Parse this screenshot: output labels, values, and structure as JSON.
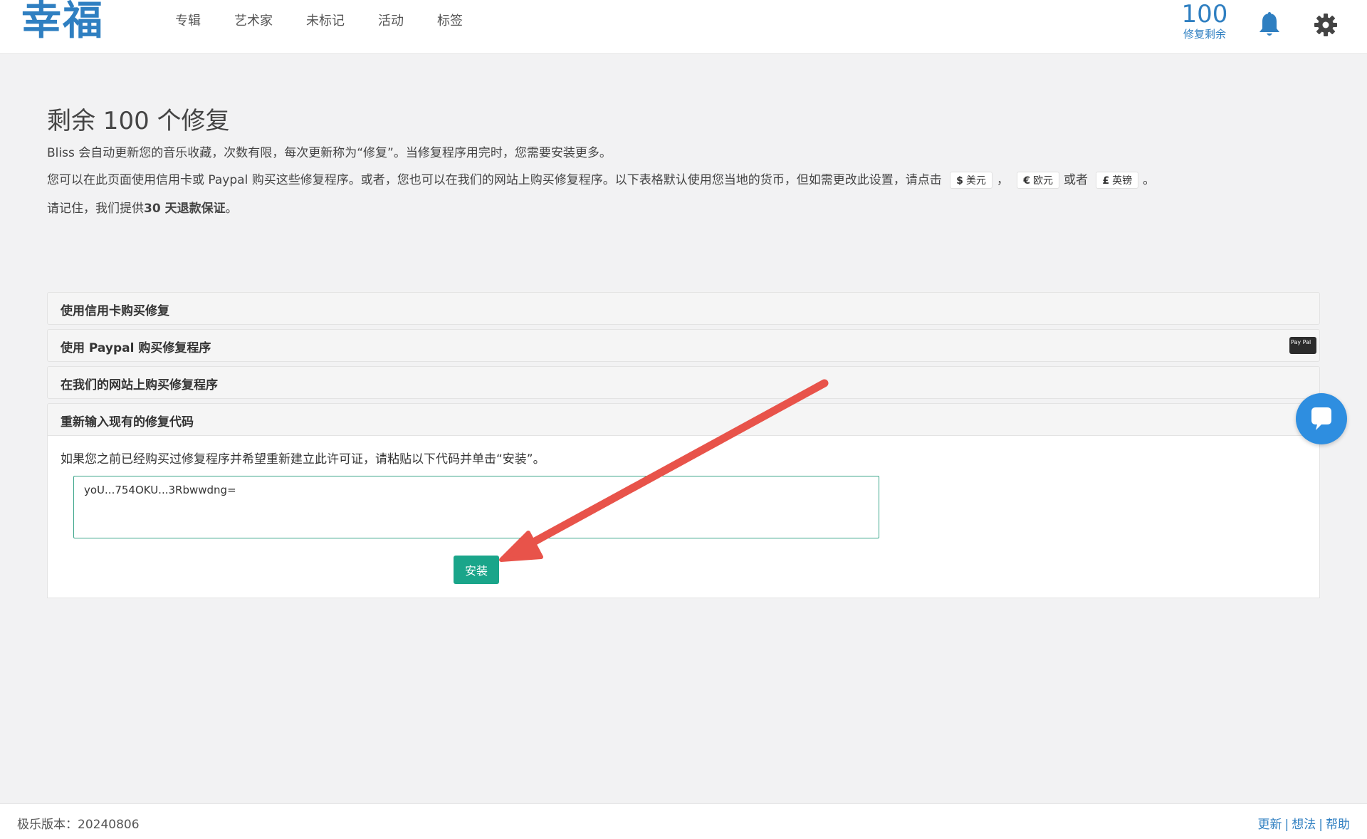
{
  "header": {
    "logo": "幸福",
    "nav": [
      "专辑",
      "艺术家",
      "未标记",
      "活动",
      "标签"
    ],
    "fix_count": "100",
    "fix_label": "修复剩余"
  },
  "main": {
    "title": "剩余 100 个修复",
    "p1": "Bliss 会自动更新您的音乐收藏，次数有限，每次更新称为“修复”。当修复程序用完时，您需要安装更多。",
    "p2_before": "您可以在此页面使用信用卡或 Paypal 购买这些修复程序。或者，您也可以在我们的网站上购买修复程序。以下表格默认使用您当地的货币，但如需更改此设置，请点击",
    "currency_usd": {
      "symbol": "$",
      "label": "美元"
    },
    "sep_comma": "，",
    "currency_eur": {
      "symbol": "€",
      "label": "欧元"
    },
    "or_text": "或者",
    "currency_gbp": {
      "symbol": "£",
      "label": "英镑"
    },
    "p2_end": "。",
    "p3_before": "请记住，我们提供",
    "p3_bold": "30 天退款保证",
    "p3_after": "。"
  },
  "accordion": {
    "items": [
      "使用信用卡购买修复",
      "使用 Paypal 购买修复程序",
      "在我们的网站上购买修复程序",
      "重新输入现有的修复代码"
    ],
    "panel_text": "如果您之前已经购买过修复程序并希望重新建立此许可证，请粘贴以下代码并单击“安装”。",
    "code_value": "yoU...754OKU...3Rbwwdng=",
    "install_label": "安装",
    "paypal_logo": "Pay\nPal"
  },
  "footer": {
    "version": "极乐版本：20240806",
    "links": [
      "更新",
      "想法",
      "帮助"
    ],
    "sep": "|"
  },
  "colors": {
    "accent": "#2f7fc1",
    "install": "#1aa58a",
    "arrow": "#e8534a"
  }
}
